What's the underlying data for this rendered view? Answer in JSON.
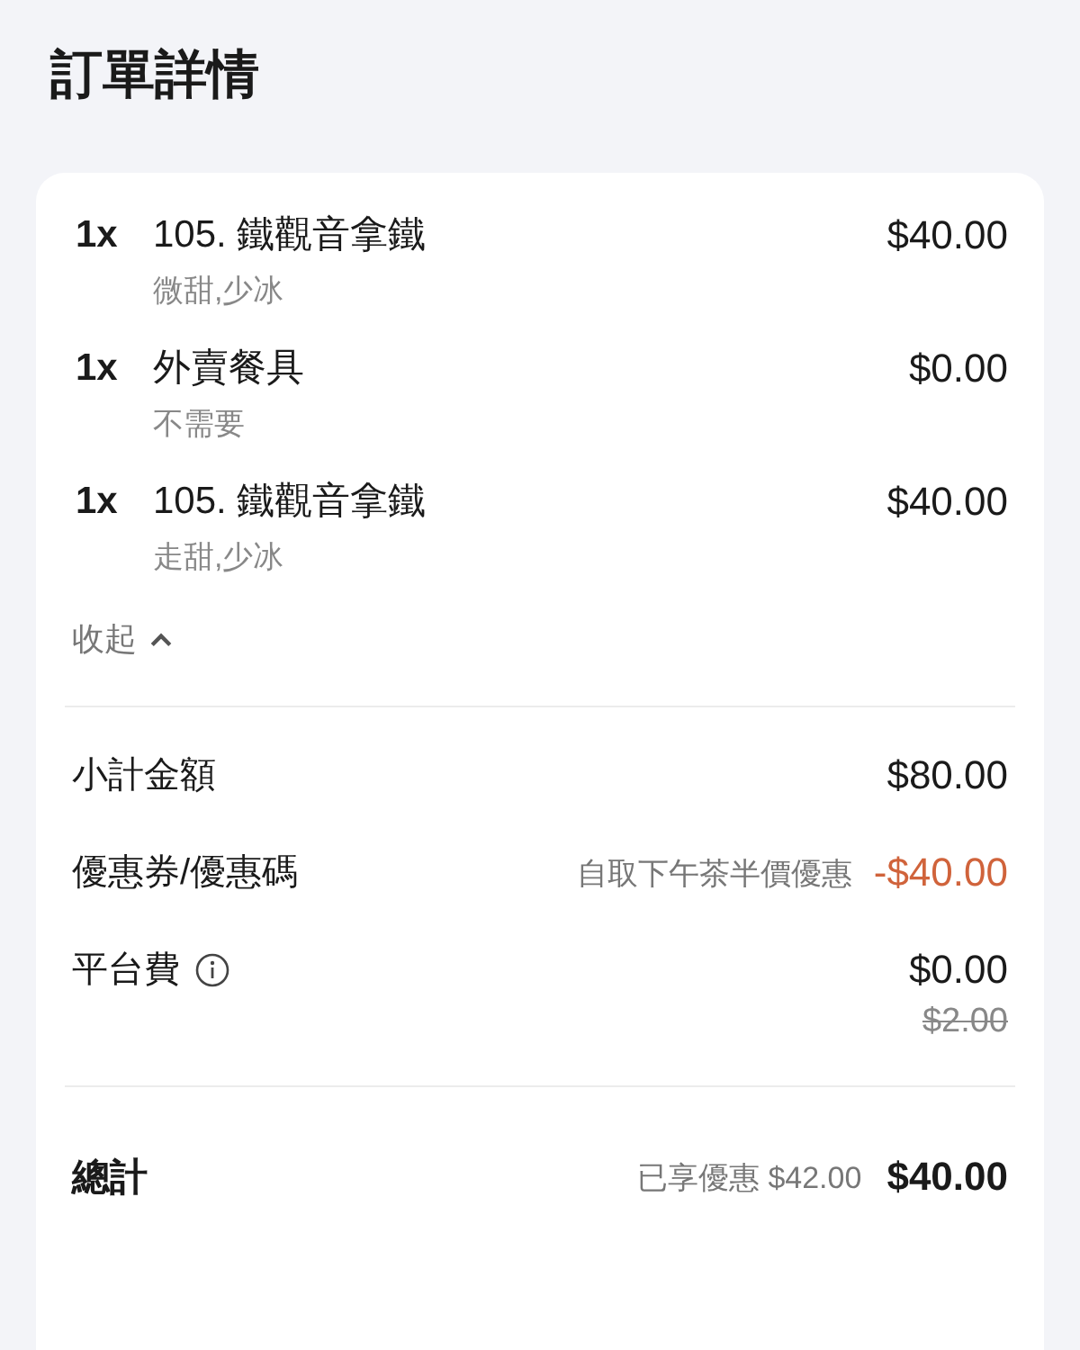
{
  "title": "訂單詳情",
  "items": [
    {
      "qty": "1x",
      "name": "105. 鐵觀音拿鐵",
      "price": "$40.00",
      "note": "微甜,少冰"
    },
    {
      "qty": "1x",
      "name": "外賣餐具",
      "price": "$0.00",
      "note": "不需要"
    },
    {
      "qty": "1x",
      "name": "105. 鐵觀音拿鐵",
      "price": "$40.00",
      "note": "走甜,少冰"
    }
  ],
  "collapse_link": {
    "label": "收起",
    "expanded": true
  },
  "summary": [
    {
      "kind": "plain",
      "label": "小計金額",
      "amount": "$80.00"
    },
    {
      "kind": "discount",
      "label": "優惠券/優惠碼",
      "note": "自取下午茶半價優惠",
      "amount": "-$40.00"
    },
    {
      "kind": "fee",
      "label": "平台費",
      "amount": "$0.00",
      "original": "$2.00"
    }
  ],
  "total": {
    "label": "總計",
    "note": "已享優惠 $42.00",
    "amount": "$40.00"
  }
}
